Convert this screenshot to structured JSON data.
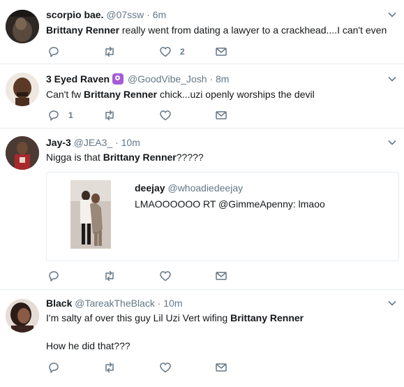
{
  "tweets": [
    {
      "name": "scorpio bae.",
      "handle": "@07ssw",
      "sep": "·",
      "time": "6m",
      "text_before": "",
      "highlight": "Brittany Renner",
      "text_after": " really went from dating a lawyer to a crackhead....I can't even",
      "reply_count": "",
      "retweet_count": "",
      "like_count": "2"
    },
    {
      "name": "3 Eyed Raven",
      "badge_icon": "purple-emoji-icon",
      "handle": "@GoodVibe_Josh",
      "sep": "·",
      "time": "8m",
      "text_before": "Can't fw ",
      "highlight": "Brittany Renner",
      "text_after": " chick...uzi openly worships the devil",
      "reply_count": "1",
      "retweet_count": "",
      "like_count": ""
    },
    {
      "name": "Jay-3",
      "handle": "@JEA3_",
      "sep": "·",
      "time": "10m",
      "text_before": "Nigga is that ",
      "highlight": "Brittany Renner",
      "text_after": "?????",
      "reply_count": "",
      "retweet_count": "",
      "like_count": "",
      "quote": {
        "name": "deejay",
        "handle": "@whoadiedeejay",
        "text": "LMAOOOOOO RT @GimmeApenny: lmaoo"
      }
    },
    {
      "name": "Black",
      "handle": "@TareakTheBlack",
      "sep": "·",
      "time": "10m",
      "text_before": "I'm salty af over this guy Lil Uzi Vert wifing ",
      "highlight": "Brittany Renner",
      "text_after": "",
      "text_line2": "How he did that???",
      "reply_count": "",
      "retweet_count": "",
      "like_count": ""
    }
  ],
  "colors": {
    "text": "#14171a",
    "muted": "#657786",
    "divider": "#e6ecf0",
    "badge": "#a55bd6"
  }
}
